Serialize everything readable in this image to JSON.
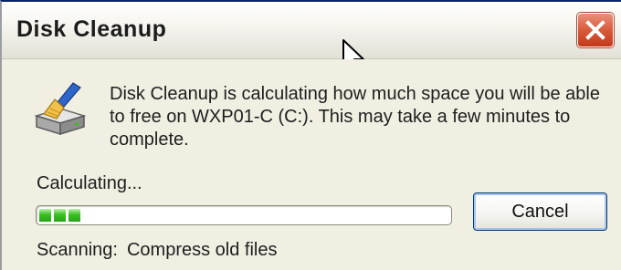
{
  "window": {
    "title": "Disk Cleanup",
    "close_icon": "close-icon"
  },
  "body": {
    "app_icon": "disk-cleanup-icon",
    "message": "Disk Cleanup is calculating how much space you will be able to free on WXP01-C (C:). This may take a few minutes to complete.",
    "status_label": "Calculating...",
    "progress": {
      "blocks_filled": 3,
      "fill_color": "#2aa41a"
    },
    "cancel_label": "Cancel",
    "scanning_label": "Scanning:",
    "scanning_value": "Compress old files"
  },
  "colors": {
    "close_button": "#d85b3c",
    "window_background": "#f1efe2"
  }
}
